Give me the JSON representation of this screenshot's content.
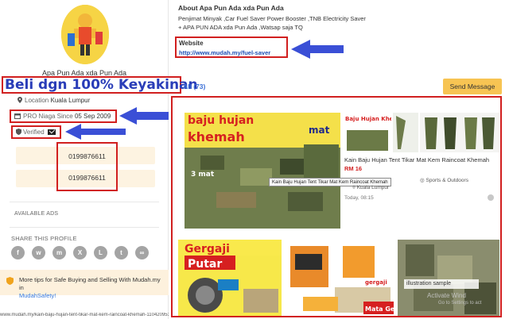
{
  "seller": {
    "name": "Apa Pun Ada xda Pun Ada",
    "location_label": "Location",
    "location_value": "Kuala Lumpur",
    "pro_label": "PRO Niaga Since",
    "pro_since": "05 Sep 2009",
    "verified_label": "Verified",
    "phones": [
      "0199876611",
      "0199876611"
    ]
  },
  "annotations": {
    "heading": "Beli dgn 100% Keyakinan"
  },
  "sections": {
    "available_ads": "AVAILABLE ADS",
    "share_profile": "SHARE THIS PROFILE"
  },
  "share_icons": [
    {
      "icon": "facebook-icon",
      "glyph": "f"
    },
    {
      "icon": "whatsapp-icon",
      "glyph": "w"
    },
    {
      "icon": "facebook-messenger-icon",
      "glyph": "m"
    },
    {
      "icon": "x-twitter-icon",
      "glyph": "X"
    },
    {
      "icon": "line-icon",
      "glyph": "L"
    },
    {
      "icon": "telegram-icon",
      "glyph": "t"
    },
    {
      "icon": "copy-link-icon",
      "glyph": "∞"
    }
  ],
  "tips": {
    "text": "More tips for Safe Buying and Selling With Mudah.my in",
    "link": "MudahSafety!"
  },
  "about": {
    "title": "About Apa Pun Ada xda Pun Ada",
    "line1": "Penjimat Minyak ,Car Fuel Saver Power Booster ,TNB Electricity Saver",
    "line2": "+ APA PUN ADA xda Pun Ada ,Watsap saja TQ"
  },
  "website": {
    "label": "Website",
    "url": "http://www.mudah.my/fuel-saver"
  },
  "tabs": {
    "all": "All (73)"
  },
  "send_message_label": "Send Message",
  "listing": {
    "title": "Kain Baju Hujan Tent Tikar Mat Kem Raincoat Khemah",
    "price": "RM 16",
    "tooltip": "Kain Baju Hujan Tent Tikar Mat Kem Raincoat Khemah",
    "category": "Sports & Outdoors",
    "location": "Kuala Lumpur",
    "date": "Today, 08:15",
    "image_text": {
      "line1": "baju hujan",
      "line2": "khemah",
      "line3": "mat",
      "line4": "3 mat",
      "thumb_title": "Baju Hujan Khemah"
    }
  },
  "second_row": {
    "card1_title": "Gergaji",
    "card1_sub": "Putar",
    "card2_title": "gergaji",
    "card2_sub": "Mata Gerg",
    "card3_label": "illustration sample"
  },
  "status_url": "www.mudah.my/kain-baju-hujan-tent-tikar-mat-kem-raincoat-khemah-110420953.htm",
  "watermark": {
    "line1": "Activate Wind",
    "line2": "Go to Settings to act"
  },
  "colors": {
    "annotation_red": "#d11f1f",
    "annotation_blue": "#2a3db8",
    "send_button": "#f7c453",
    "link_blue": "#1e4fb5",
    "price_red": "#d11f1f"
  }
}
